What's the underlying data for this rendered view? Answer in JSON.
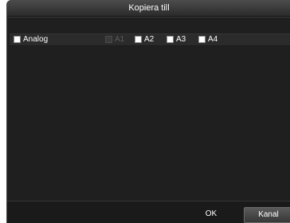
{
  "dialog": {
    "title": "Kopiera till",
    "analog": {
      "label": "Analog",
      "checked": false
    },
    "channels": [
      {
        "label": "A1",
        "enabled": false
      },
      {
        "label": "A2",
        "enabled": true
      },
      {
        "label": "A3",
        "enabled": true
      },
      {
        "label": "A4",
        "enabled": true
      }
    ],
    "ok_label": "OK",
    "cancel_label": "Kanal"
  }
}
